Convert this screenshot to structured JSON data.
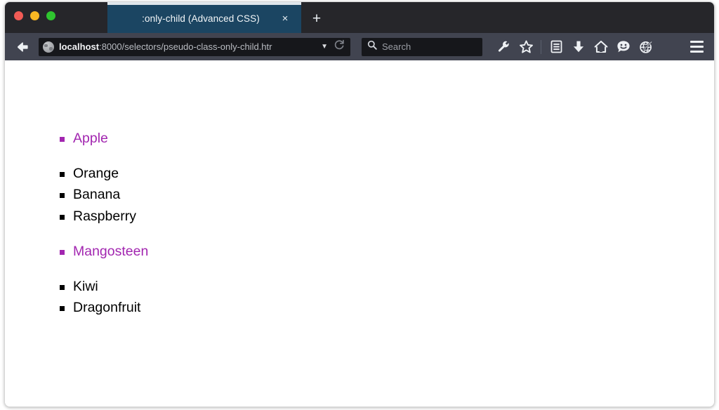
{
  "window": {
    "traffic_lights": [
      {
        "name": "close",
        "color": "#f15b55"
      },
      {
        "name": "minimize",
        "color": "#f8b823"
      },
      {
        "name": "maximize",
        "color": "#2fc52f"
      }
    ]
  },
  "tabs": {
    "active": {
      "title": ":only-child (Advanced CSS)",
      "close_label": "×"
    },
    "new_tab_label": "+"
  },
  "navbar": {
    "back_icon": "back-arrow-icon",
    "url": {
      "favicon": "globe-icon",
      "host": "localhost",
      "path": ":8000/selectors/pseudo-class-only-child.htr",
      "full": "localhost:8000/selectors/pseudo-class-only-child.htr",
      "dropdown_label": "▼",
      "reload_icon": "reload-icon"
    },
    "search": {
      "icon": "search-icon",
      "placeholder": "Search"
    },
    "icons": [
      {
        "name": "wrench-icon",
        "label": "Developer tools"
      },
      {
        "name": "star-icon",
        "label": "Bookmark this page"
      },
      {
        "name": "reader-list-icon",
        "label": "Reading list"
      },
      {
        "name": "download-icon",
        "label": "Downloads"
      },
      {
        "name": "home-icon",
        "label": "Home"
      },
      {
        "name": "smiley-feedback-icon",
        "label": "Feedback"
      },
      {
        "name": "globe-pencil-icon",
        "label": "Synced tabs"
      }
    ],
    "menu_icon": "hamburger-menu-icon"
  },
  "page": {
    "accent_color": "#a226b0",
    "text_color": "#000000",
    "background_color": "#ffffff",
    "lists": [
      {
        "items": [
          {
            "text": "Apple",
            "only_child": true
          }
        ]
      },
      {
        "items": [
          {
            "text": "Orange",
            "only_child": false
          },
          {
            "text": "Banana",
            "only_child": false
          },
          {
            "text": "Raspberry",
            "only_child": false
          }
        ]
      },
      {
        "items": [
          {
            "text": "Mangosteen",
            "only_child": true
          }
        ]
      },
      {
        "items": [
          {
            "text": "Kiwi",
            "only_child": false
          },
          {
            "text": "Dragonfruit",
            "only_child": false
          }
        ]
      }
    ]
  }
}
